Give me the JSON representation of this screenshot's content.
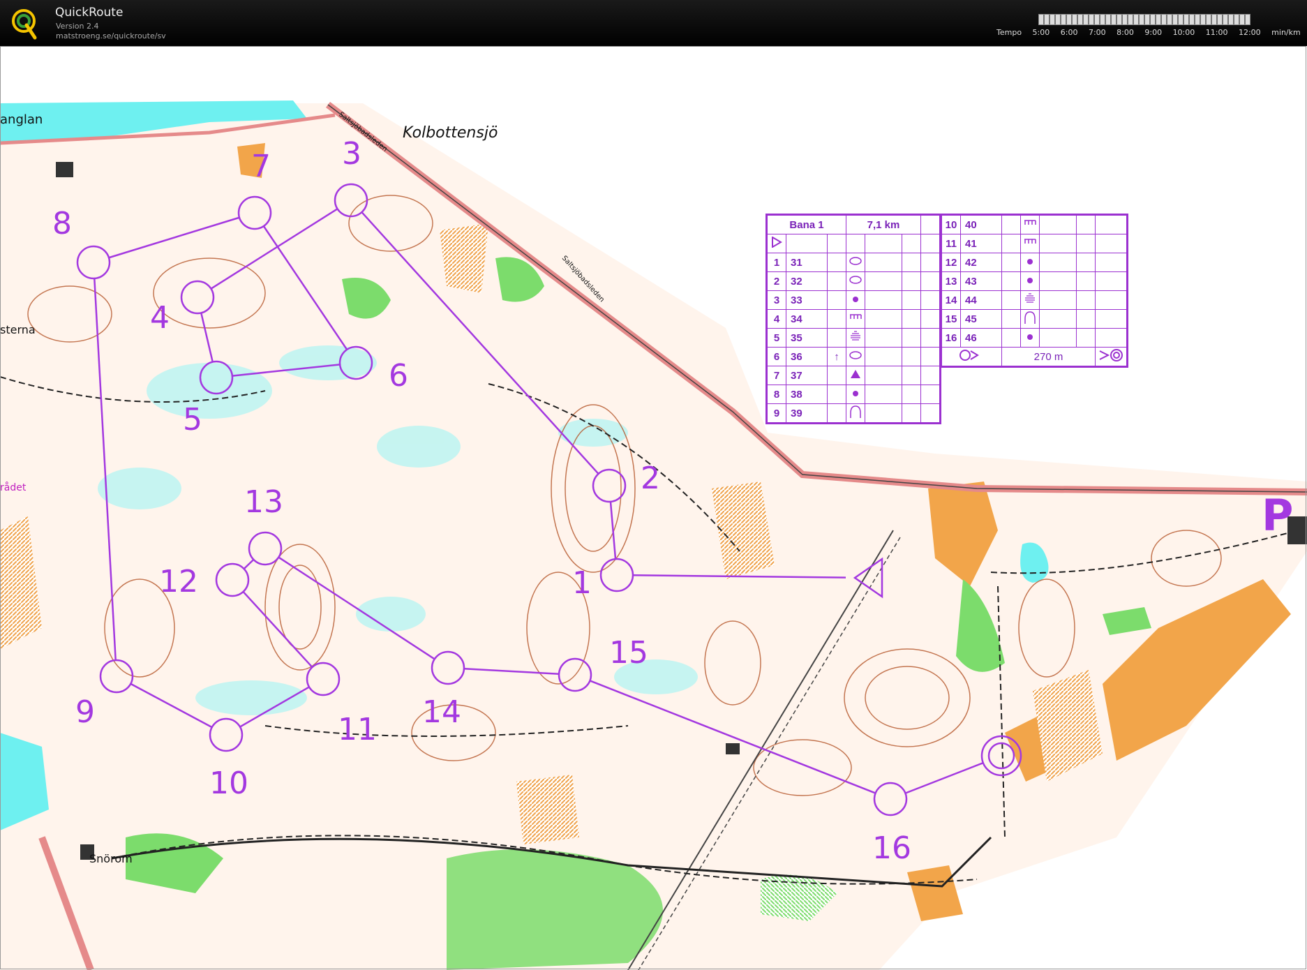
{
  "app": {
    "title": "QuickRoute",
    "version": "Version 2.4",
    "url": "matstroeng.se/quickroute/sv"
  },
  "tempo": {
    "label": "Tempo",
    "ticks": [
      "5:00",
      "6:00",
      "7:00",
      "8:00",
      "9:00",
      "10:00",
      "11:00",
      "12:00"
    ],
    "unit": "min/km"
  },
  "map": {
    "place_names": [
      "anglan",
      "Kolbottensjö",
      "sterna",
      "rådet",
      "Snörom"
    ],
    "road_names": [
      "Saltsjöbadsleden",
      "Saltsjöbadsleden"
    ],
    "parking_symbol": "P",
    "controls": [
      "1",
      "2",
      "3",
      "4",
      "5",
      "6",
      "7",
      "8",
      "9",
      "10",
      "11",
      "12",
      "13",
      "14",
      "15",
      "16"
    ]
  },
  "control_descriptions": {
    "course_name": "Bana 1",
    "length": "7,1 km",
    "rows_left": [
      {
        "num": "1",
        "code": "31",
        "symbol": "oval"
      },
      {
        "num": "2",
        "code": "32",
        "symbol": "oval"
      },
      {
        "num": "3",
        "code": "33",
        "symbol": "dot"
      },
      {
        "num": "4",
        "code": "34",
        "symbol": "comb"
      },
      {
        "num": "5",
        "code": "35",
        "symbol": "lines"
      },
      {
        "num": "6",
        "code": "36",
        "symbol": "oval"
      },
      {
        "num": "7",
        "code": "37",
        "symbol": "triangle"
      },
      {
        "num": "8",
        "code": "38",
        "symbol": "dot"
      },
      {
        "num": "9",
        "code": "39",
        "symbol": "spur"
      }
    ],
    "rows_right": [
      {
        "num": "10",
        "code": "40",
        "symbol": "comb"
      },
      {
        "num": "11",
        "code": "41",
        "symbol": "comb"
      },
      {
        "num": "12",
        "code": "42",
        "symbol": "dot"
      },
      {
        "num": "13",
        "code": "43",
        "symbol": "dot"
      },
      {
        "num": "14",
        "code": "44",
        "symbol": "lines"
      },
      {
        "num": "15",
        "code": "45",
        "symbol": "spur"
      },
      {
        "num": "16",
        "code": "46",
        "symbol": "dot"
      }
    ],
    "finish_distance": "270 m"
  },
  "colors": {
    "course": "#a338e0",
    "contour": "#b5562a",
    "water": "#6ef0f0",
    "green": "#7cdc6c",
    "open": "#f2a54a",
    "road": "#e58a8a"
  }
}
